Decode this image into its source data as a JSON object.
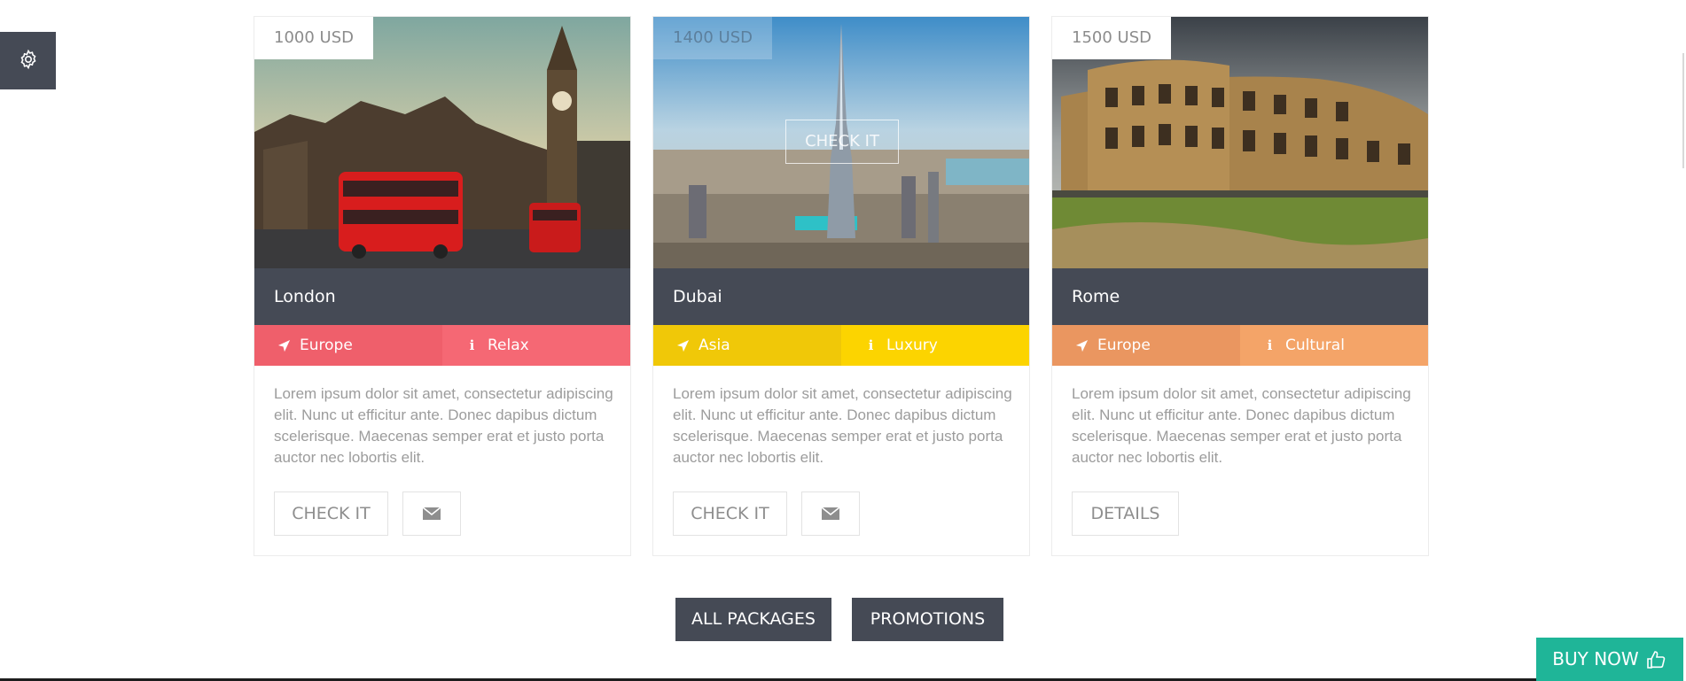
{
  "settings": {
    "icon": "gear-icon"
  },
  "cards": [
    {
      "price": "1000 USD",
      "title": "London",
      "location": "Europe",
      "category": "Relax",
      "location_color": "#ef5f6b",
      "category_color": "#f56874",
      "description": "Lorem ipsum dolor sit amet, consectetur adipiscing elit. Nunc ut efficitur ante. Donec dapibus dictum scelerisque. Maecenas semper erat et justo porta auctor nec lobortis elit.",
      "primary_button": "CHECK IT",
      "mail_icon": "envelope-icon"
    },
    {
      "price": "1400 USD",
      "title": "Dubai",
      "location": "Asia",
      "category": "Luxury",
      "location_color": "#f0c808",
      "category_color": "#fcd400",
      "overlay_button": "CHECK IT",
      "description": "Lorem ipsum dolor sit amet, consectetur adipiscing elit. Nunc ut efficitur ante. Donec dapibus dictum scelerisque. Maecenas semper erat et justo porta auctor nec lobortis elit.",
      "primary_button": "CHECK IT",
      "mail_icon": "envelope-icon"
    },
    {
      "price": "1500 USD",
      "title": "Rome",
      "location": "Europe",
      "category": "Cultural",
      "location_color": "#ea9660",
      "category_color": "#f4a468",
      "description": "Lorem ipsum dolor sit amet, consectetur adipiscing elit. Nunc ut efficitur ante. Donec dapibus dictum scelerisque. Maecenas semper erat et justo porta auctor nec lobortis elit.",
      "primary_button": "DETAILS"
    }
  ],
  "actions": {
    "all_packages": "ALL PACKAGES",
    "promotions": "PROMOTIONS"
  },
  "buy_now": {
    "label": "BUY NOW",
    "icon": "thumbs-up-icon",
    "color": "#1fb598"
  },
  "colors": {
    "dark": "#454a55",
    "background": "#ffffff"
  }
}
